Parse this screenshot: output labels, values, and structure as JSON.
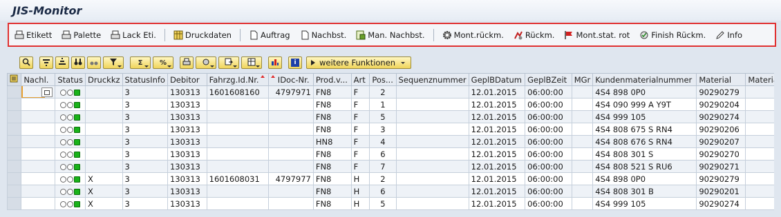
{
  "window": {
    "title": "JIS-Monitor"
  },
  "app_toolbar": [
    {
      "label": "Etikett",
      "icon": "printer-icon"
    },
    {
      "label": "Palette",
      "icon": "printer-icon"
    },
    {
      "label": "Lack Eti.",
      "icon": "printer-icon"
    },
    {
      "label": "Druckdaten",
      "icon": "table-icon"
    },
    {
      "label": "Auftrag",
      "icon": "document-icon"
    },
    {
      "label": "Nachbst.",
      "icon": "document-icon"
    },
    {
      "label": "Man. Nachbst.",
      "icon": "document-edit-icon"
    },
    {
      "label": "Mont.rückm.",
      "icon": "gear-icon"
    },
    {
      "label": "Rückm.",
      "icon": "confirm-icon"
    },
    {
      "label": "Mont.stat. rot",
      "icon": "red-flag-icon"
    },
    {
      "label": "Finish Rückm.",
      "icon": "finish-icon"
    },
    {
      "label": "Info",
      "icon": "pencil-icon"
    }
  ],
  "alv_toolbar": {
    "more_functions_label": "weitere Funktionen"
  },
  "grid": {
    "columns": [
      "Nachl.",
      "Status",
      "Druckkz",
      "StatusInfo",
      "Debitor",
      "Fahrzg.Id.Nr.",
      "IDoc-Nr.",
      "Prod.v...",
      "Art",
      "Pos...",
      "Sequenznummer",
      "GeplBDatum",
      "GeplBZeit",
      "MGr",
      "Kundenmaterialnummer",
      "Material",
      "Materia"
    ],
    "rows": [
      [
        "",
        "",
        "",
        "3",
        "130313",
        "1601608160",
        "4797971",
        "FN8",
        "F",
        "2",
        "",
        "12.01.2015",
        "06:00:00",
        "",
        "4S4 898 0P0",
        "90290279",
        ""
      ],
      [
        "",
        "",
        "",
        "3",
        "130313",
        "",
        "",
        "FN8",
        "F",
        "1",
        "",
        "12.01.2015",
        "06:00:00",
        "",
        "4S4 090 999 A  Y9T",
        "90290204",
        ""
      ],
      [
        "",
        "",
        "",
        "3",
        "130313",
        "",
        "",
        "FN8",
        "F",
        "5",
        "",
        "12.01.2015",
        "06:00:00",
        "",
        "4S4 999 105",
        "90290274",
        ""
      ],
      [
        "",
        "",
        "",
        "3",
        "130313",
        "",
        "",
        "FN8",
        "F",
        "3",
        "",
        "12.01.2015",
        "06:00:00",
        "",
        "4S4 808 675 S  RN4",
        "90290206",
        ""
      ],
      [
        "",
        "",
        "",
        "3",
        "130313",
        "",
        "",
        "HN8",
        "F",
        "4",
        "",
        "12.01.2015",
        "06:00:00",
        "",
        "4S4 808 676 S  RN4",
        "90290207",
        ""
      ],
      [
        "",
        "",
        "",
        "3",
        "130313",
        "",
        "",
        "FN8",
        "F",
        "6",
        "",
        "12.01.2015",
        "06:00:00",
        "",
        "4S4 808 301 S",
        "90290270",
        ""
      ],
      [
        "",
        "",
        "",
        "3",
        "130313",
        "",
        "",
        "FN8",
        "F",
        "7",
        "",
        "12.01.2015",
        "06:00:00",
        "",
        "4S4 808 521 S  RU6",
        "90290271",
        ""
      ],
      [
        "",
        "",
        "X",
        "3",
        "130313",
        "1601608031",
        "4797977",
        "FN8",
        "H",
        "2",
        "",
        "12.01.2015",
        "06:00:00",
        "",
        "4S4 898 0P0",
        "90290279",
        ""
      ],
      [
        "",
        "",
        "X",
        "3",
        "130313",
        "",
        "",
        "FN8",
        "H",
        "6",
        "",
        "12.01.2015",
        "06:00:00",
        "",
        "4S4 808 301 B",
        "90290201",
        ""
      ],
      [
        "",
        "",
        "X",
        "3",
        "130313",
        "",
        "",
        "FN8",
        "H",
        "5",
        "",
        "12.01.2015",
        "06:00:00",
        "",
        "4S4 999 105",
        "90290274",
        ""
      ]
    ]
  },
  "colors": {
    "highlight_border": "#e03030",
    "alv_button": "#f0d45a",
    "status_green": "#19b319"
  }
}
